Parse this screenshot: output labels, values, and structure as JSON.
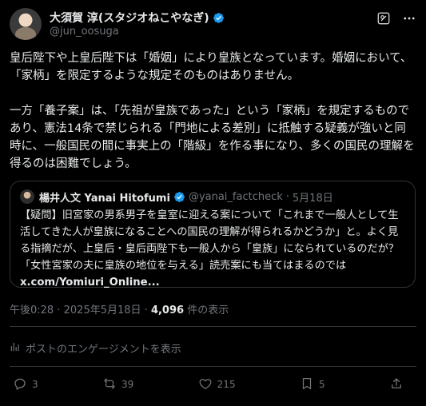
{
  "author": {
    "display_name": "大須賀 淳(スタジオねこやなぎ)",
    "handle": "@jun_oosuga"
  },
  "tweet": {
    "paragraph1": "皇后陛下や上皇后陛下は「婚姻」により皇族となっています。婚姻において、「家柄」を限定するような規定そのものはありません。",
    "paragraph2": "一方「養子案」は、「先祖が皇族であった」という「家柄」を規定するものであり、憲法14条で禁じられる「門地による差別」に抵触する疑義が強いと同時に、一般国民の間に事実上の「階級」を作る事になり、多くの国民の理解を得るのは困難でしょう。"
  },
  "quote": {
    "display_name": "楊井人文 Yanai Hitofumi",
    "handle": "@yanai_factcheck",
    "dot": "·",
    "date": "5月18日",
    "text": "【疑問】旧宮家の男系男子を皇室に迎える案について「これまで一般人として生活してきた人が皇族になることへの国民の理解が得られるかどうか」と。よく見る指摘だが、上皇后・皇后両陛下も一般人から「皇族」になられているのだが？「女性宮家の夫に皇族の地位を与える」読売案にも当てはまるのでは",
    "link": "x.com/Yomiuri_Online..."
  },
  "meta": {
    "time": "午後0:28",
    "dot": "·",
    "date": "2025年5月18日",
    "dot2": "·",
    "views_count": "4,096",
    "views_label": "件の表示"
  },
  "engagements_label": "ポストのエンゲージメントを表示",
  "actions": {
    "replies": "3",
    "reposts": "39",
    "likes": "215",
    "bookmarks": "5"
  },
  "colors": {
    "background": "#000000",
    "text": "#e7e9ea",
    "muted": "#71767b",
    "border": "#2f3336",
    "verified": "#1d9bf0"
  }
}
